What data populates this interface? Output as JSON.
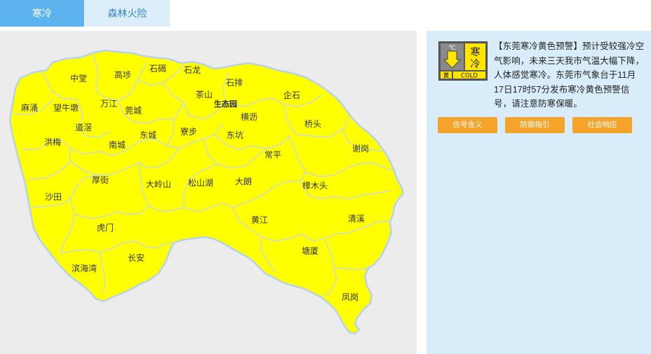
{
  "tabs": [
    {
      "label": "寒冷",
      "active": true
    },
    {
      "label": "森林火险",
      "active": false
    }
  ],
  "map": {
    "fill_color": "#ffff00",
    "border_color": "#b9d3e6",
    "towns": [
      "中堂",
      "高埗",
      "石碣",
      "石龙",
      "石排",
      "麻涌",
      "望牛墩",
      "万江",
      "莞城",
      "茶山",
      "生态园",
      "企石",
      "道滘",
      "横沥",
      "洪梅",
      "东城",
      "寮步",
      "东坑",
      "桥头",
      "南城",
      "谢岗",
      "常平",
      "厚街",
      "大岭山",
      "松山湖",
      "大朗",
      "樟木头",
      "沙田",
      "虎门",
      "黄江",
      "清溪",
      "塘厦",
      "长安",
      "滨海湾",
      "凤岗"
    ]
  },
  "warning": {
    "icon": {
      "thermometer_symbol": "℃",
      "type_label": "寒冷",
      "level_label": "黄",
      "english_label": "COLD",
      "level_color": "#ffe600"
    },
    "text": "【东莞寒冷黄色预警】预计受较强冷空气影响，未来三天我市气温大幅下降，人体感觉寒冷。东莞市气象台于11月17日17时57分发布寒冷黄色预警信号，请注意防寒保暖。",
    "buttons": {
      "meaning": "信号含义",
      "guide": "防御指引",
      "response": "社会响应"
    },
    "button_color": "#f5a32a"
  }
}
